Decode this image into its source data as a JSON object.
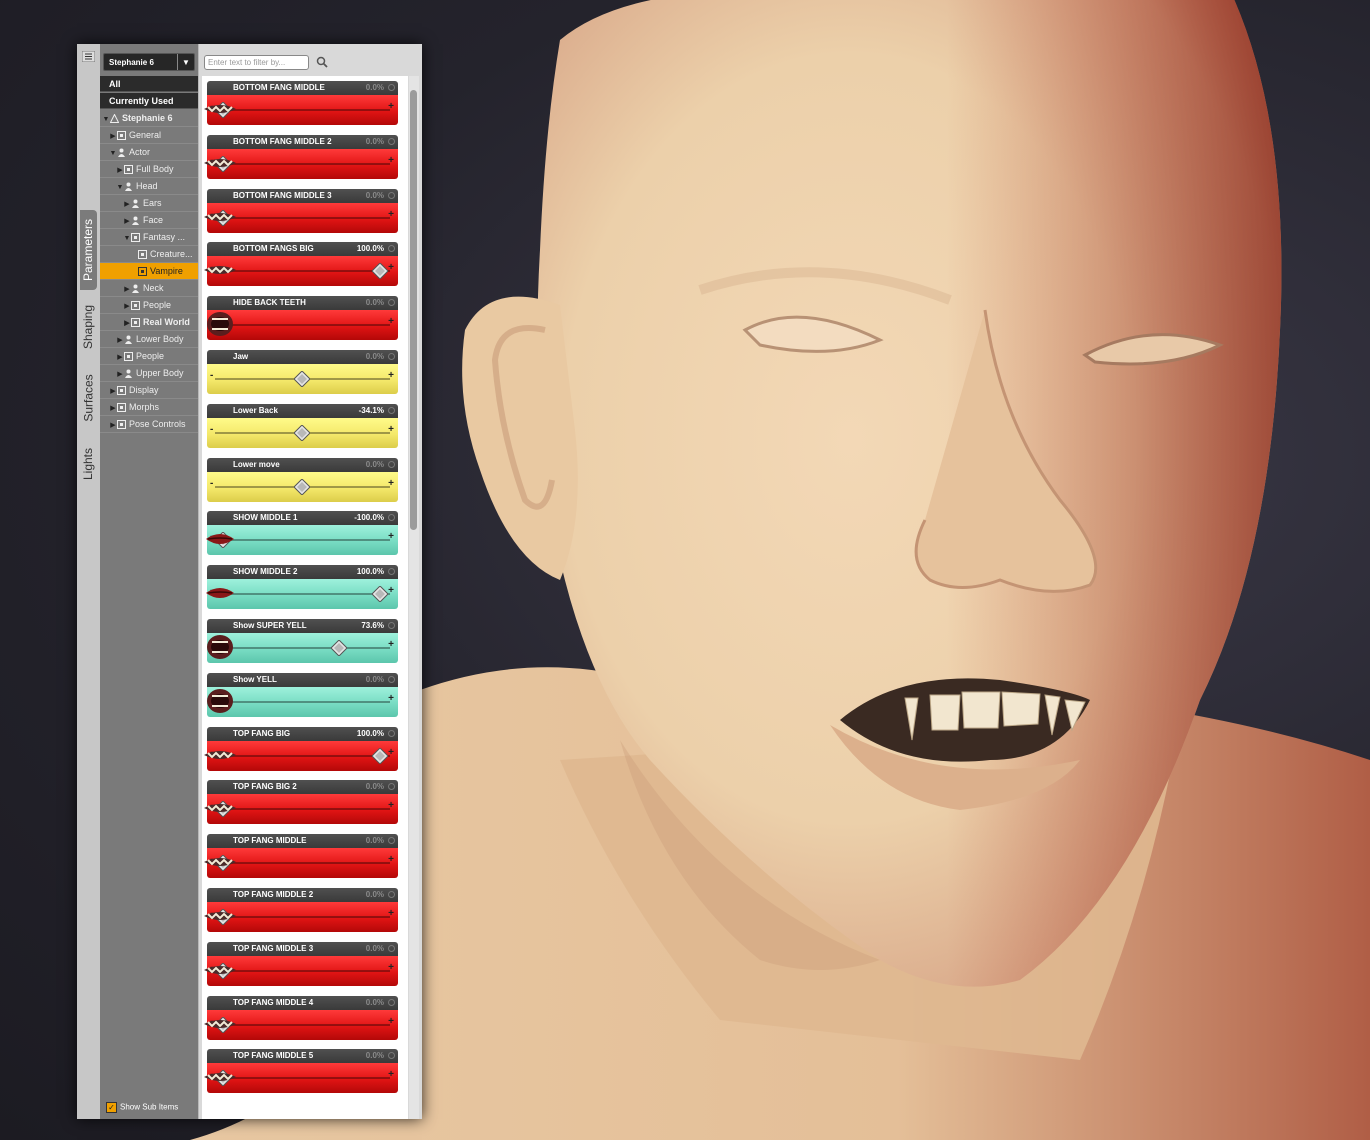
{
  "figure_selector": {
    "value": "Stephanie 6",
    "dropdown_icon": "chevron-down-icon"
  },
  "vertical_tabs": [
    {
      "label": "Parameters",
      "active": true
    },
    {
      "label": "Shaping",
      "active": false
    },
    {
      "label": "Surfaces",
      "active": false
    },
    {
      "label": "Lights",
      "active": false
    }
  ],
  "categories": [
    "All",
    "Currently Used"
  ],
  "tree": [
    {
      "label": "Stephanie 6",
      "indent": 0,
      "toggle": "▼",
      "icon": "figure-icon",
      "bold": true
    },
    {
      "label": "General",
      "indent": 1,
      "toggle": "▶",
      "icon": "group-icon"
    },
    {
      "label": "Actor",
      "indent": 1,
      "toggle": "▼",
      "icon": "person-icon"
    },
    {
      "label": "Full Body",
      "indent": 2,
      "toggle": "▶",
      "icon": "group-icon"
    },
    {
      "label": "Head",
      "indent": 2,
      "toggle": "▼",
      "icon": "person-icon"
    },
    {
      "label": "Ears",
      "indent": 3,
      "toggle": "▶",
      "icon": "person-icon"
    },
    {
      "label": "Face",
      "indent": 3,
      "toggle": "▶",
      "icon": "person-icon"
    },
    {
      "label": "Fantasy ...",
      "indent": 3,
      "toggle": "▼",
      "icon": "group-icon"
    },
    {
      "label": "Creature...",
      "indent": 4,
      "toggle": "",
      "icon": "group-icon"
    },
    {
      "label": "Vampire",
      "indent": 4,
      "toggle": "",
      "icon": "group-icon",
      "selected": true
    },
    {
      "label": "Neck",
      "indent": 3,
      "toggle": "▶",
      "icon": "person-icon"
    },
    {
      "label": "People",
      "indent": 3,
      "toggle": "▶",
      "icon": "group-icon"
    },
    {
      "label": "Real World",
      "indent": 3,
      "toggle": "▶",
      "icon": "group-icon",
      "bold": true
    },
    {
      "label": "Lower Body",
      "indent": 2,
      "toggle": "▶",
      "icon": "person-icon"
    },
    {
      "label": "People",
      "indent": 2,
      "toggle": "▶",
      "icon": "group-icon"
    },
    {
      "label": "Upper Body",
      "indent": 2,
      "toggle": "▶",
      "icon": "person-icon"
    },
    {
      "label": "Display",
      "indent": 1,
      "toggle": "▶",
      "icon": "group-icon"
    },
    {
      "label": "Morphs",
      "indent": 1,
      "toggle": "▶",
      "icon": "group-icon"
    },
    {
      "label": "Pose Controls",
      "indent": 1,
      "toggle": "▶",
      "icon": "group-icon"
    }
  ],
  "show_sub_items": {
    "label": "Show Sub Items",
    "checked": true
  },
  "filter": {
    "placeholder": "Enter text to filter by...",
    "icon": "search-icon"
  },
  "sliders": [
    {
      "label": "BOTTOM FANG MIDDLE",
      "value_text": "0.0%",
      "fraction": 0.0,
      "color": "red",
      "thumb": "teeth"
    },
    {
      "label": "BOTTOM FANG MIDDLE 2",
      "value_text": "0.0%",
      "fraction": 0.0,
      "color": "red",
      "thumb": "teeth"
    },
    {
      "label": "BOTTOM FANG MIDDLE 3",
      "value_text": "0.0%",
      "fraction": 0.0,
      "color": "red",
      "thumb": "teeth"
    },
    {
      "label": "BOTTOM FANGS BIG",
      "value_text": "100.0%",
      "fraction": 1.0,
      "color": "red",
      "thumb": "teeth"
    },
    {
      "label": "HIDE BACK TEETH",
      "value_text": "0.0%",
      "fraction": 0.0,
      "color": "red",
      "thumb": "mouth"
    },
    {
      "label": "Jaw",
      "value_text": "0.0%",
      "fraction": 0.5,
      "color": "yellow",
      "thumb": ""
    },
    {
      "label": "Lower Back",
      "value_text": "-34.1%",
      "fraction": 0.5,
      "color": "yellow",
      "thumb": ""
    },
    {
      "label": "Lower move",
      "value_text": "0.0%",
      "fraction": 0.5,
      "color": "yellow",
      "thumb": ""
    },
    {
      "label": "SHOW MIDDLE 1",
      "value_text": "-100.0%",
      "fraction": 0.0,
      "color": "teal",
      "thumb": "lips"
    },
    {
      "label": "SHOW MIDDLE 2",
      "value_text": "100.0%",
      "fraction": 1.0,
      "color": "teal",
      "thumb": "lips"
    },
    {
      "label": "Show SUPER YELL",
      "value_text": "73.6%",
      "fraction": 0.736,
      "color": "teal",
      "thumb": "mouth"
    },
    {
      "label": "Show YELL",
      "value_text": "0.0%",
      "fraction": 0.0,
      "color": "teal",
      "thumb": "mouth"
    },
    {
      "label": "TOP FANG BIG",
      "value_text": "100.0%",
      "fraction": 1.0,
      "color": "red",
      "thumb": "teeth"
    },
    {
      "label": "TOP FANG BIG 2",
      "value_text": "0.0%",
      "fraction": 0.0,
      "color": "red",
      "thumb": "teeth"
    },
    {
      "label": "TOP FANG MIDDLE",
      "value_text": "0.0%",
      "fraction": 0.0,
      "color": "red",
      "thumb": "teeth"
    },
    {
      "label": "TOP FANG MIDDLE 2",
      "value_text": "0.0%",
      "fraction": 0.0,
      "color": "red",
      "thumb": "teeth"
    },
    {
      "label": "TOP FANG MIDDLE 3",
      "value_text": "0.0%",
      "fraction": 0.0,
      "color": "red",
      "thumb": "teeth"
    },
    {
      "label": "TOP FANG MIDDLE 4",
      "value_text": "0.0%",
      "fraction": 0.0,
      "color": "red",
      "thumb": "teeth"
    },
    {
      "label": "TOP FANG MIDDLE 5",
      "value_text": "0.0%",
      "fraction": 0.0,
      "color": "red",
      "thumb": "teeth"
    }
  ],
  "colors": {
    "selection": "#f0a000",
    "red": "#e01414",
    "yellow": "#f4e86a",
    "teal": "#78dcc3",
    "skin": "#efd2ae"
  }
}
